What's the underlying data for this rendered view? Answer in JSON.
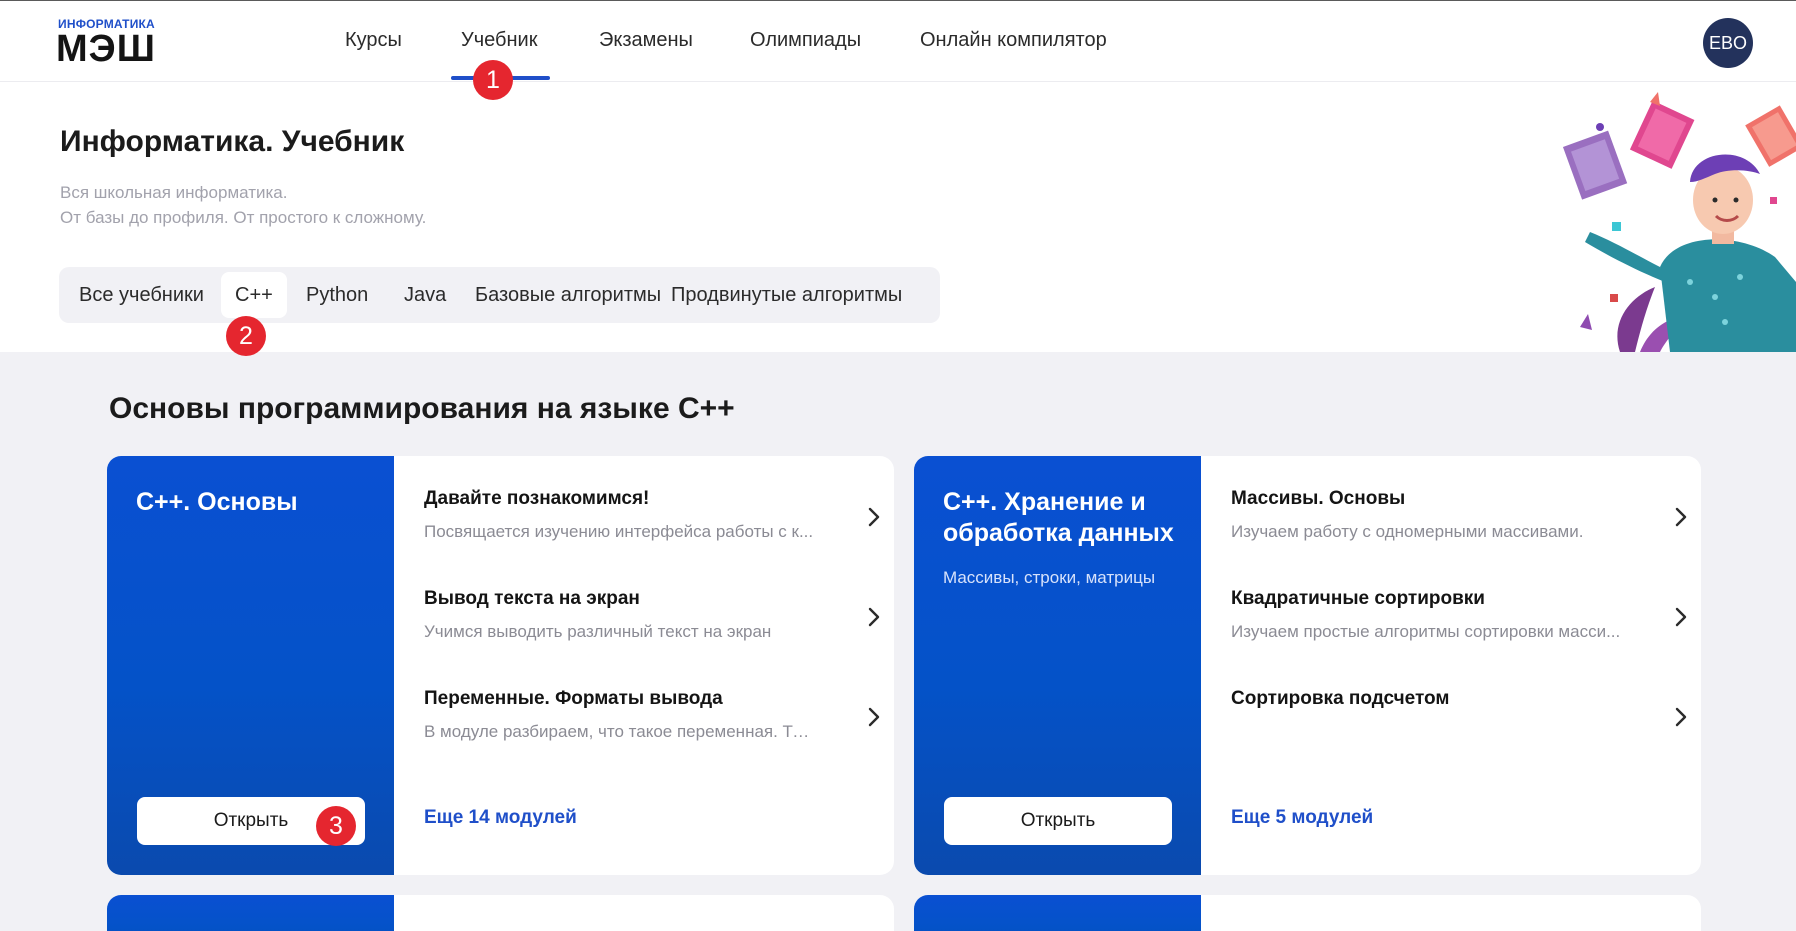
{
  "header": {
    "logo_small": "ИНФОРМАТИКА",
    "logo_big": "МЭШ",
    "nav": [
      "Курсы",
      "Учебник",
      "Экзамены",
      "Олимпиады",
      "Онлайн компилятор"
    ],
    "active_nav": "Учебник",
    "avatar_initials": "EBO"
  },
  "badges": [
    "1",
    "2",
    "3"
  ],
  "hero": {
    "title": "Информатика. Учебник",
    "subtitle_line1": "Вся школьная информатика.",
    "subtitle_line2": "От базы до профиля. От простого к сложному.",
    "tabs": [
      "Все учебники",
      "C++",
      "Python",
      "Java",
      "Базовые алгоритмы",
      "Продвинутые алгоритмы"
    ],
    "active_tab": "C++"
  },
  "section": {
    "title": "Основы программирования на языке С++"
  },
  "cards": [
    {
      "title": "С++. Основы",
      "description": "",
      "open_label": "Открыть",
      "modules": [
        {
          "title": "Давайте познакомимся!",
          "desc": "Посвящается изучению интерфейса работы с к..."
        },
        {
          "title": "Вывод текста на экран",
          "desc": "Учимся выводить различный текст на экран"
        },
        {
          "title": "Переменные. Форматы вывода",
          "desc": "В модуле разбираем, что такое переменная. Ти..."
        }
      ],
      "more": "Еще 14 модулей"
    },
    {
      "title": "С++. Хранение и обработка данных",
      "description": "Массивы, строки, матрицы",
      "open_label": "Открыть",
      "modules": [
        {
          "title": "Массивы. Основы",
          "desc": "Изучаем работу с одномерными массивами."
        },
        {
          "title": "Квадратичные сортировки",
          "desc": "Изучаем простые алгоритмы сортировки масси..."
        },
        {
          "title": "Сортировка подсчетом",
          "desc": ""
        }
      ],
      "more": "Еще 5 модулей"
    }
  ],
  "colors": {
    "accent": "#1f4fc9",
    "card_blue": "#0452c8",
    "badge_red": "#e5262f",
    "page_bg": "#f1f1f5"
  },
  "icons": [
    "chevron-right-icon",
    "illustration-reader"
  ]
}
